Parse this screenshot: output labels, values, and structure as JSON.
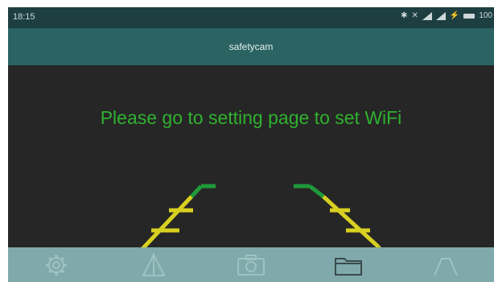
{
  "status_bar": {
    "time": "18:15",
    "battery_level": "100"
  },
  "app_bar": {
    "title": "safetycam"
  },
  "camera_view": {
    "message": "Please go to setting page to set WiFi",
    "message_color": "#2fb12f",
    "guide_colors": {
      "near": "#d8d020",
      "far": "#1f9a3a"
    }
  },
  "toolbar": {
    "buttons": [
      {
        "icon": "gear-icon"
      },
      {
        "icon": "road-perspective-icon"
      },
      {
        "icon": "camera-icon"
      },
      {
        "icon": "folder-icon"
      },
      {
        "icon": "parking-guide-icon"
      }
    ],
    "background": "#7fa9aa"
  }
}
